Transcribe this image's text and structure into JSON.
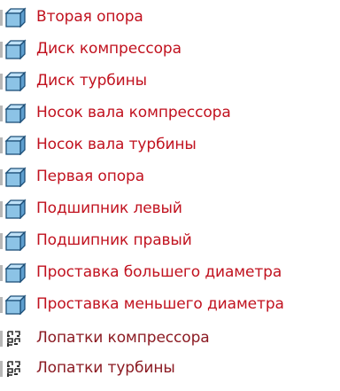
{
  "colors": {
    "part_text": "#c1121f",
    "part_text_alt": "#c4141f",
    "pattern_text": "#8b1a22",
    "cube_fill": "#8cc3e6",
    "cube_edge": "#1d4f78",
    "pattern_fill": "#2e2e2e"
  },
  "tree": {
    "items": [
      {
        "label": "Вторая опора",
        "icon": "part-cube-icon"
      },
      {
        "label": "Диск компрессора",
        "icon": "part-cube-icon"
      },
      {
        "label": "Диск турбины",
        "icon": "part-cube-icon"
      },
      {
        "label": "Носок вала компрессора",
        "icon": "part-cube-icon"
      },
      {
        "label": "Носок вала турбины",
        "icon": "part-cube-icon"
      },
      {
        "label": "Первая опора",
        "icon": "part-cube-icon"
      },
      {
        "label": "Подшипник левый",
        "icon": "part-cube-icon"
      },
      {
        "label": "Подшипник правый",
        "icon": "part-cube-icon"
      },
      {
        "label": "Проставка большего диаметра",
        "icon": "part-cube-icon"
      },
      {
        "label": "Проставка меньшего диаметра",
        "icon": "part-cube-icon"
      },
      {
        "label": "Лопатки компрессора",
        "icon": "pattern-array-icon"
      },
      {
        "label": "Лопатки турбины",
        "icon": "pattern-array-icon"
      }
    ]
  }
}
